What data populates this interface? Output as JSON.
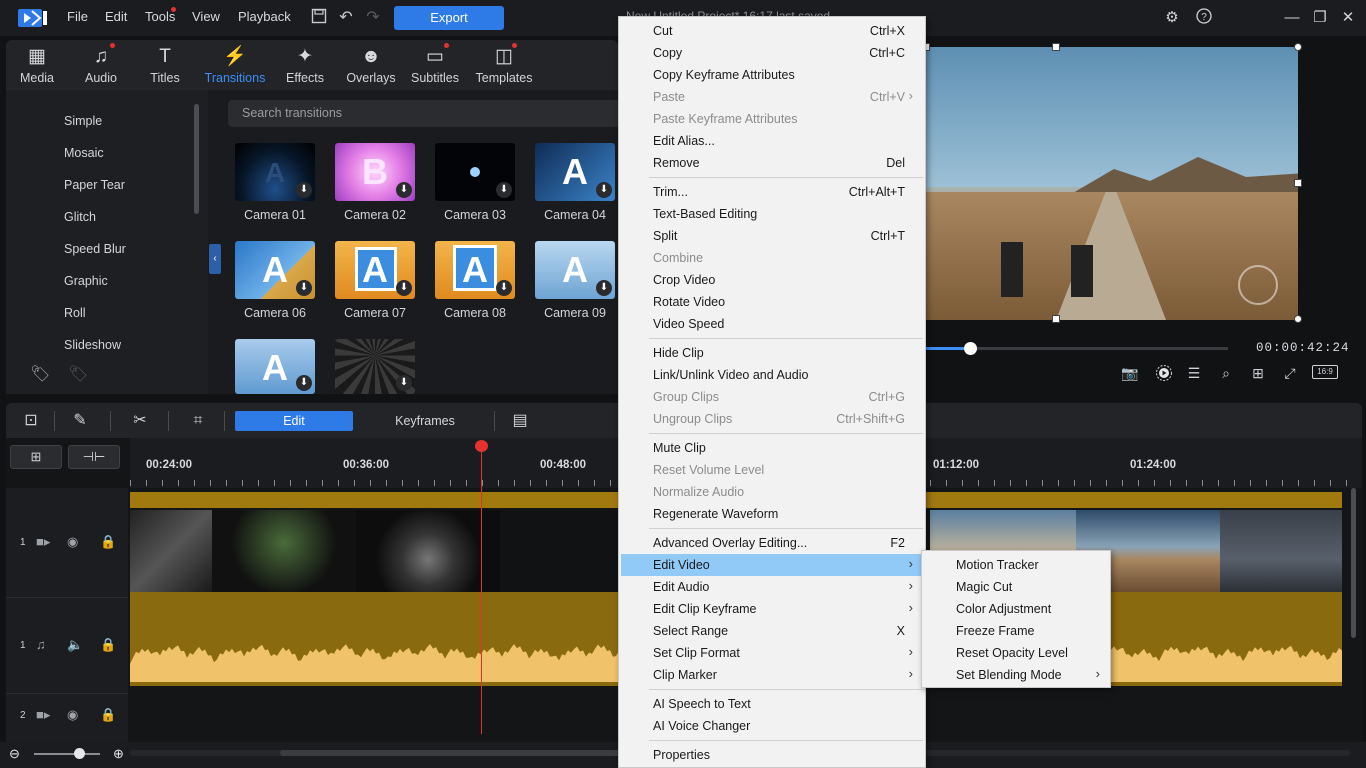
{
  "menubar": {
    "items": [
      "File",
      "Edit",
      "Tools",
      "View",
      "Playback"
    ],
    "export_label": "Export",
    "project_title": "New Untitled Project* 16:17 last saved"
  },
  "rooms": [
    {
      "label": "Media",
      "icon": "media-icon"
    },
    {
      "label": "Audio",
      "icon": "music-note-icon"
    },
    {
      "label": "Titles",
      "icon": "titles-icon"
    },
    {
      "label": "Transitions",
      "icon": "transitions-icon"
    },
    {
      "label": "Effects",
      "icon": "effects-icon"
    },
    {
      "label": "Overlays",
      "icon": "overlays-icon"
    },
    {
      "label": "Subtitles",
      "icon": "subtitles-icon"
    },
    {
      "label": "Templates",
      "icon": "templates-icon"
    }
  ],
  "library": {
    "categories": [
      "Simple",
      "Mosaic",
      "Paper Tear",
      "Glitch",
      "Speed Blur",
      "Graphic",
      "Roll",
      "Slideshow"
    ],
    "search_placeholder": "Search transitions",
    "thumbnails": [
      {
        "label": "Camera 01",
        "glyph": "A"
      },
      {
        "label": "Camera 02",
        "glyph": "B"
      },
      {
        "label": "Camera 03",
        "glyph": ""
      },
      {
        "label": "Camera 04",
        "glyph": "A"
      },
      {
        "label": "Camera 06",
        "glyph": "A"
      },
      {
        "label": "Camera 07",
        "glyph": "A"
      },
      {
        "label": "Camera 08",
        "glyph": "A"
      },
      {
        "label": "Camera 09",
        "glyph": "A"
      },
      {
        "label": "",
        "glyph": "A"
      },
      {
        "label": "",
        "glyph": ""
      }
    ]
  },
  "preview": {
    "timecode": "00:00:42:24",
    "aspect_ratio": "16:9",
    "progress_fraction": 0.15
  },
  "timeline": {
    "edit_tab": "Edit",
    "keyframes_tab": "Keyframes",
    "ruler_labels": [
      "00:24:00",
      "00:36:00",
      "00:48:00",
      "01:12:00",
      "01:24:00"
    ],
    "tracks": [
      {
        "number": "1",
        "type": "video"
      },
      {
        "number": "1",
        "type": "audio"
      },
      {
        "number": "2",
        "type": "video"
      }
    ]
  },
  "context_menu": {
    "items": [
      {
        "label": "Cut",
        "shortcut": "Ctrl+X"
      },
      {
        "label": "Copy",
        "shortcut": "Ctrl+C"
      },
      {
        "label": "Copy Keyframe Attributes",
        "shortcut": ""
      },
      {
        "label": "Paste",
        "shortcut": "Ctrl+V",
        "disabled": true,
        "arrow": true
      },
      {
        "label": "Paste Keyframe Attributes",
        "shortcut": "",
        "disabled": true
      },
      {
        "label": "Edit Alias...",
        "shortcut": ""
      },
      {
        "label": "Remove",
        "shortcut": "Del"
      },
      {
        "label": "Trim...",
        "shortcut": "Ctrl+Alt+T"
      },
      {
        "label": "Text-Based Editing",
        "shortcut": ""
      },
      {
        "label": "Split",
        "shortcut": "Ctrl+T"
      },
      {
        "label": "Combine",
        "shortcut": "",
        "disabled": true
      },
      {
        "label": "Crop Video",
        "shortcut": ""
      },
      {
        "label": "Rotate Video",
        "shortcut": ""
      },
      {
        "label": "Video Speed",
        "shortcut": ""
      },
      {
        "label": "Hide Clip",
        "shortcut": ""
      },
      {
        "label": "Link/Unlink Video and Audio",
        "shortcut": ""
      },
      {
        "label": "Group Clips",
        "shortcut": "Ctrl+G",
        "disabled": true
      },
      {
        "label": "Ungroup Clips",
        "shortcut": "Ctrl+Shift+G",
        "disabled": true
      },
      {
        "label": "Mute Clip",
        "shortcut": ""
      },
      {
        "label": "Reset Volume Level",
        "shortcut": "",
        "disabled": true
      },
      {
        "label": "Normalize Audio",
        "shortcut": "",
        "disabled": true
      },
      {
        "label": "Regenerate Waveform",
        "shortcut": ""
      },
      {
        "label": "Advanced Overlay Editing...",
        "shortcut": "F2"
      },
      {
        "label": "Edit Video",
        "shortcut": "",
        "arrow": true,
        "highlight": true
      },
      {
        "label": "Edit Audio",
        "shortcut": "",
        "arrow": true
      },
      {
        "label": "Edit Clip Keyframe",
        "shortcut": "",
        "arrow": true
      },
      {
        "label": "Select Range",
        "shortcut": "X"
      },
      {
        "label": "Set Clip Format",
        "shortcut": "",
        "arrow": true
      },
      {
        "label": "Clip Marker",
        "shortcut": "",
        "arrow": true
      },
      {
        "label": "AI Speech to Text",
        "shortcut": ""
      },
      {
        "label": "AI Voice Changer",
        "shortcut": ""
      },
      {
        "label": "Properties",
        "shortcut": ""
      }
    ],
    "submenu": [
      {
        "label": "Motion Tracker"
      },
      {
        "label": "Magic Cut"
      },
      {
        "label": "Color Adjustment"
      },
      {
        "label": "Freeze Frame"
      },
      {
        "label": "Reset Opacity Level"
      },
      {
        "label": "Set Blending Mode",
        "arrow": true
      }
    ]
  }
}
